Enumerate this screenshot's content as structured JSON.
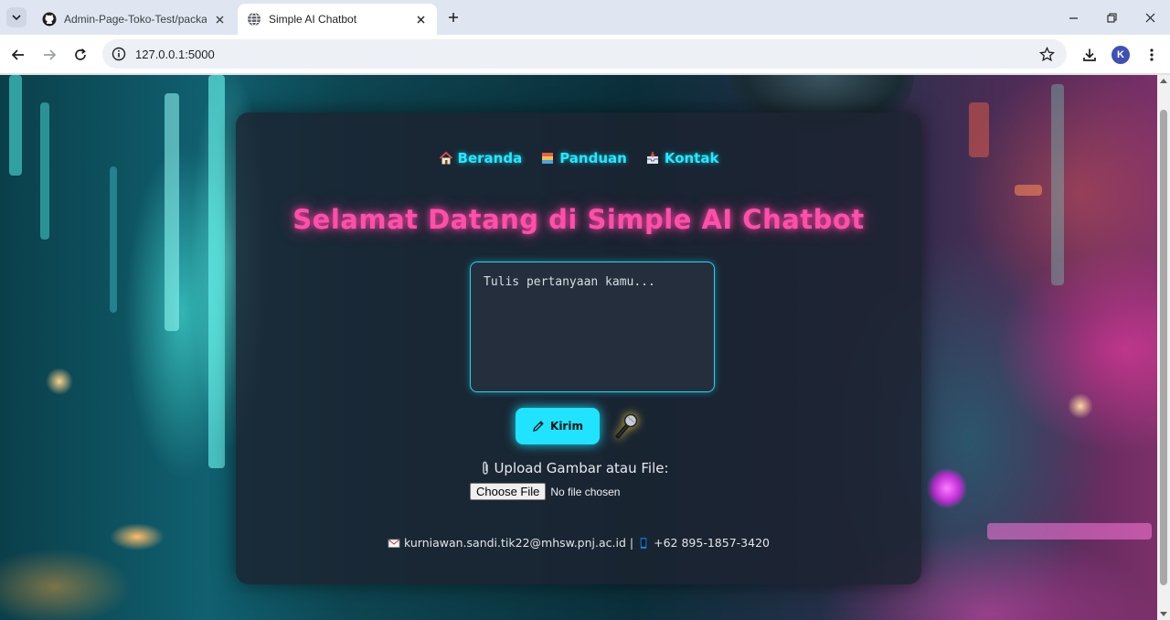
{
  "browser": {
    "tabs": [
      {
        "title": "Admin-Page-Toko-Test/package",
        "favicon": "github-icon",
        "active": false
      },
      {
        "title": "Simple AI Chatbot",
        "favicon": "globe-icon",
        "active": true
      }
    ],
    "url": "127.0.0.1:5000",
    "profile_initial": "K"
  },
  "nav": {
    "items": [
      {
        "label": "Beranda",
        "icon": "house-icon"
      },
      {
        "label": "Panduan",
        "icon": "book-icon"
      },
      {
        "label": "Kontak",
        "icon": "inbox-icon"
      }
    ]
  },
  "hero": {
    "title": "Selamat Datang di Simple AI Chatbot"
  },
  "chat": {
    "placeholder": "Tulis pertanyaan kamu...",
    "send_label": "Kirim",
    "send_icon": "pencil-icon",
    "mic_icon": "microphone-icon"
  },
  "upload": {
    "label": "Upload Gambar atau File:",
    "choose_label": "Choose File",
    "status": "No file chosen"
  },
  "footer": {
    "email": "kurniawan.sandi.tik22@mhsw.pnj.ac.id",
    "separator": "|",
    "phone": "+62 895-1857-3420"
  },
  "colors": {
    "accent_cyan": "#1fe3ff",
    "title_pink": "#ff4fa8",
    "card_bg": "#1c2230"
  }
}
